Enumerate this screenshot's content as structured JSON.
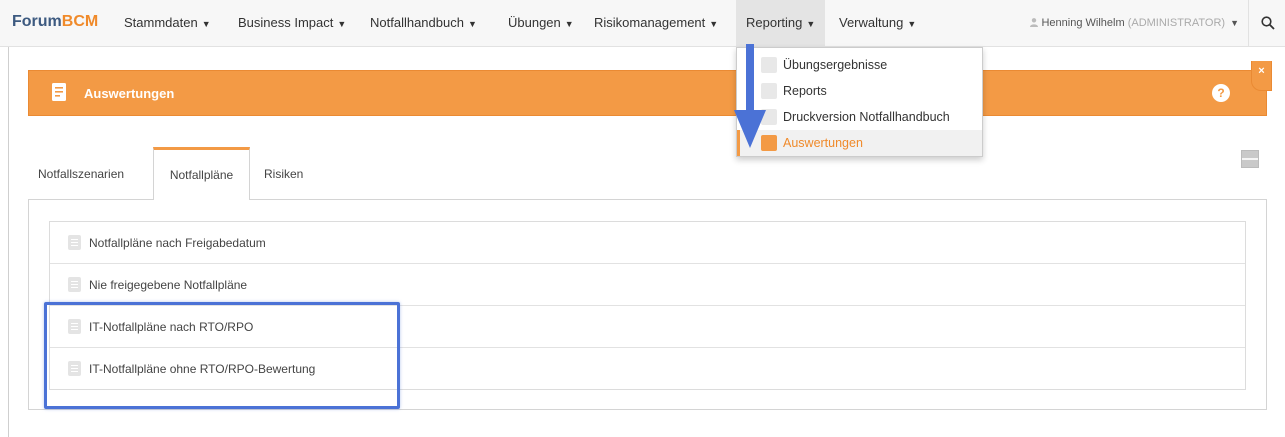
{
  "brand": {
    "part1": "Forum",
    "part2": "BCM"
  },
  "nav": {
    "items": [
      {
        "label": "Stammdaten"
      },
      {
        "label": "Business Impact"
      },
      {
        "label": "Notfallhandbuch"
      },
      {
        "label": "Übungen"
      },
      {
        "label": "Risikomanagement"
      },
      {
        "label": "Reporting"
      },
      {
        "label": "Verwaltung"
      }
    ],
    "active": "Reporting",
    "user_name": "Henning Wilhelm",
    "user_role": "(ADMINISTRATOR)"
  },
  "dropdown": {
    "items": [
      {
        "label": "Übungsergebnisse",
        "icon": "exercise-results-icon"
      },
      {
        "label": "Reports",
        "icon": "reports-icon"
      },
      {
        "label": "Druckversion Notfallhandbuch",
        "icon": "print-icon"
      },
      {
        "label": "Auswertungen",
        "icon": "evaluation-icon",
        "active": true
      }
    ]
  },
  "panel": {
    "title": "Auswertungen",
    "help": "?",
    "close": "×"
  },
  "tabs": [
    {
      "label": "Notfallszenarien"
    },
    {
      "label": "Notfallpläne",
      "active": true
    },
    {
      "label": "Risiken"
    }
  ],
  "list": {
    "items": [
      {
        "label": "Notfallpläne nach Freigabedatum"
      },
      {
        "label": "Nie freigegebene Notfallpläne"
      },
      {
        "label": "IT-Notfallpläne nach RTO/RPO"
      },
      {
        "label": "IT-Notfallpläne ohne RTO/RPO-Bewertung"
      }
    ]
  },
  "colors": {
    "accent": "#f39a45",
    "brand_blue": "#3d5a80",
    "highlight": "#4b72d6"
  }
}
